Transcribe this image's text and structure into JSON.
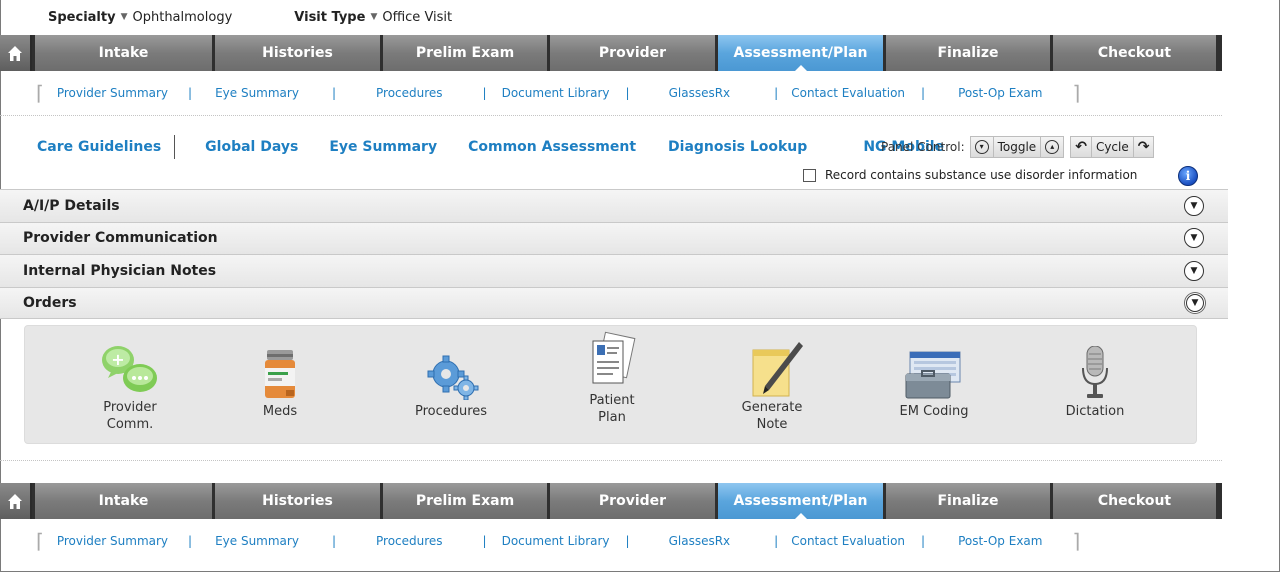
{
  "header": {
    "specialty_label": "Specialty",
    "specialty_value": "Ophthalmology",
    "visit_type_label": "Visit Type",
    "visit_type_value": "Office Visit"
  },
  "nav": {
    "tabs": [
      {
        "label": "Intake"
      },
      {
        "label": "Histories"
      },
      {
        "label": "Prelim Exam"
      },
      {
        "label": "Provider"
      },
      {
        "label": "Assessment/Plan",
        "active": true
      },
      {
        "label": "Finalize"
      },
      {
        "label": "Checkout"
      }
    ],
    "active_color": "#5aa5dd",
    "tab_color": "#7b7b7b"
  },
  "subnav": {
    "items": [
      "Provider Summary",
      "Eye Summary",
      "Procedures",
      "Document Library",
      "GlassesRx",
      "Contact Evaluation",
      "Post-Op Exam"
    ],
    "separator": "|"
  },
  "toolbar": {
    "links": [
      "Care Guidelines",
      "Global Days",
      "Eye Summary",
      "Common Assessment",
      "Diagnosis Lookup",
      "NG Mobile"
    ],
    "panel_control_label": "Panel Control:",
    "toggle_label": "Toggle",
    "cycle_label": "Cycle",
    "link_color": "#1e7fc2"
  },
  "substance": {
    "label": "Record contains substance use disorder information",
    "checked": false,
    "info_glyph": "i"
  },
  "sections": [
    {
      "title": "A/I/P Details",
      "icon": "chevron-down-icon"
    },
    {
      "title": "Provider Communication",
      "icon": "chevron-down-icon"
    },
    {
      "title": "Internal Physician Notes",
      "icon": "chevron-down-icon"
    },
    {
      "title": "Orders",
      "icon": "chevron-down-icon"
    }
  ],
  "orders": {
    "items": [
      {
        "label": "Provider\nComm.",
        "icon": "chat-bubbles-icon"
      },
      {
        "label": "Meds",
        "icon": "medicine-bottle-icon"
      },
      {
        "label": "Procedures",
        "icon": "gears-icon"
      },
      {
        "label": "Patient\nPlan",
        "icon": "documents-icon"
      },
      {
        "label": "Generate\nNote",
        "icon": "note-pen-icon"
      },
      {
        "label": "EM Coding",
        "icon": "coding-toolbox-icon"
      },
      {
        "label": "Dictation",
        "icon": "microphone-icon"
      }
    ]
  }
}
